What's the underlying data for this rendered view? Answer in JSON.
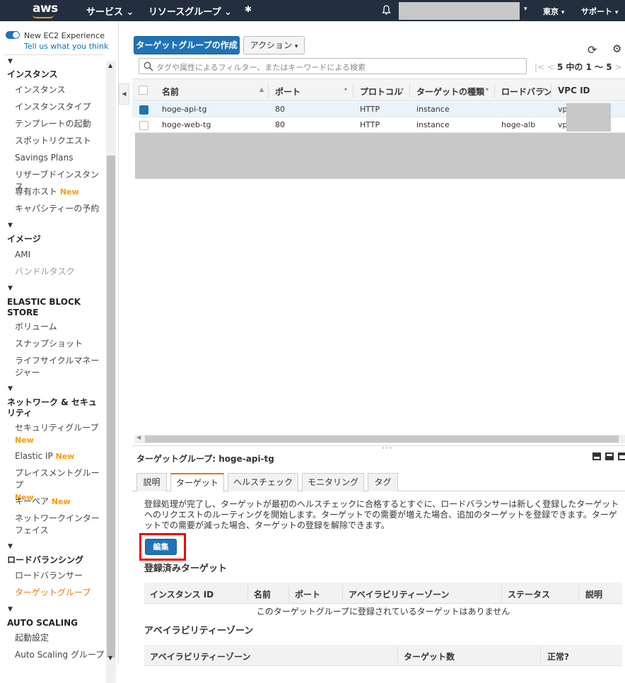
{
  "topnav": {
    "logo": "aws",
    "services": "サービス",
    "resource_groups": "リソースグループ",
    "region": "東京",
    "support": "サポート"
  },
  "sidebar": {
    "experience_label": "New EC2 Experience",
    "experience_link": "Tell us what you think",
    "new_badge": "New",
    "sections": {
      "instances": "インスタンス",
      "images": "イメージ",
      "ebs": "ELASTIC BLOCK STORE",
      "network": "ネットワーク & セキュリティ",
      "lb": "ロードバランシング",
      "autoscaling": "AUTO SCALING"
    },
    "items": {
      "instances": "インスタンス",
      "instance_types": "インスタンスタイプ",
      "launch_templates": "テンプレートの起動",
      "spot_requests": "スポットリクエスト",
      "savings_plans": "Savings Plans",
      "reserved_instances": "リザーブドインスタンス",
      "dedicated_hosts": "専有ホスト",
      "capacity_reservations": "キャパシティーの予約",
      "ami": "AMI",
      "bundle_tasks": "バンドルタスク",
      "volumes": "ボリューム",
      "snapshots": "スナップショット",
      "lifecycle_manager": "ライフサイクルマネージャー",
      "security_groups": "セキュリティグループ",
      "elastic_ip": "Elastic IP",
      "placement_groups": "プレイスメントグループ",
      "key_pairs": "キーペア",
      "network_interfaces": "ネットワークインターフェイス",
      "load_balancers": "ロードバランサー",
      "target_groups": "ターゲットグループ",
      "launch_configurations": "起動設定",
      "auto_scaling_groups": "Auto Scaling グループ"
    }
  },
  "toolbar": {
    "create_button": "ターゲットグループの作成",
    "actions_button": "アクション"
  },
  "search": {
    "placeholder": "タグや属性によるフィルター、またはキーワードによる検索"
  },
  "pager": {
    "text": "5 中の 1 ～ 5"
  },
  "table": {
    "columns": {
      "name": "名前",
      "port": "ポート",
      "protocol": "プロトコル",
      "target_type": "ターゲットの種類",
      "load_balancer": "ロードバラン",
      "vpc_id": "VPC ID"
    },
    "rows": [
      {
        "name": "hoge-api-tg",
        "port": "80",
        "protocol": "HTTP",
        "target_type": "instance",
        "load_balancer": "",
        "vpc": "vpc"
      },
      {
        "name": "hoge-web-tg",
        "port": "80",
        "protocol": "HTTP",
        "target_type": "instance",
        "load_balancer": "hoge-alb",
        "vpc": "vpc"
      }
    ]
  },
  "detail": {
    "title": "ターゲットグループ: hoge-api-tg",
    "tabs": {
      "description": "説明",
      "targets": "ターゲット",
      "health_check": "ヘルスチェック",
      "monitoring": "モニタリング",
      "tags": "タグ"
    },
    "desc_text": "登録処理が完了し、ターゲットが最初のヘルスチェックに合格するとすぐに、ロードバランサーは新しく登録したターゲットへのリクエストのルーティングを開始します。ターゲットでの需要が増えた場合、追加のターゲットを登録できます。ターゲットでの需要が減った場合、ターゲットの登録を解除できます。",
    "edit_button": "編集",
    "registered_title": "登録済みターゲット",
    "registered_columns": {
      "instance_id": "インスタンス ID",
      "name": "名前",
      "port": "ポート",
      "az": "アベイラビリティーゾーン",
      "status": "ステータス",
      "description": "説明"
    },
    "empty_text": "このターゲットグループに登録されているターゲットはありません",
    "az_title": "アベイラビリティーゾーン",
    "az_columns": {
      "az": "アベイラビリティーゾーン",
      "target_count": "ターゲット数",
      "healthy": "正常?"
    }
  }
}
